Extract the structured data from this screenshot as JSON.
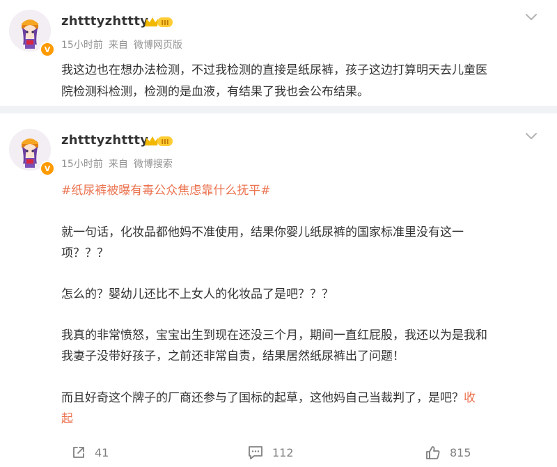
{
  "comments": [
    {
      "username": "zhtttyzhttty",
      "level_badge": "III",
      "verified_badge": "V",
      "time": "15小时前",
      "source_prefix": "来自",
      "source": "微博网页版",
      "text_lines": [
        "我这边也在想办法检测，不过我检测的直接是纸尿裤，孩子这边打算明天去儿童医",
        "院检测科检测，检测的是血液，有结果了我也会公布结果。"
      ]
    },
    {
      "username": "zhtttyzhttty",
      "level_badge": "III",
      "verified_badge": "V",
      "time": "15小时前",
      "source_prefix": "来自",
      "source": "微博搜索",
      "hashtag": "#纸尿裤被曝有毒公众焦虑靠什么抚平#",
      "paragraphs": [
        "就一句话，化妆品都他妈不准使用，结果你婴儿纸尿裤的国家标准里没有这一",
        "项？？？",
        "怎么的？婴幼儿还比不上女人的化妆品了是吧？？？",
        "我真的非常愤怒，宝宝出生到现在还没三个月，期间一直红屁股，我还以为是我和",
        "我妻子没带好孩子，之前还非常自责，结果居然纸尿裤出了问题！",
        "而且好奇这个牌子的厂商还参与了国标的起草，这他妈自己当裁判了，是吧？",
        "起"
      ],
      "collapse_label_1": "收",
      "actions": {
        "share_count": "41",
        "comment_count": "112",
        "like_count": "815"
      }
    }
  ],
  "colors": {
    "accent": "#eb7350",
    "meta": "#939393",
    "verified": "#ff9a00",
    "background": "#f1f2f5"
  },
  "icons": [
    "chevron-down-icon",
    "crown-level-icon",
    "share-icon",
    "comment-icon",
    "like-icon"
  ]
}
